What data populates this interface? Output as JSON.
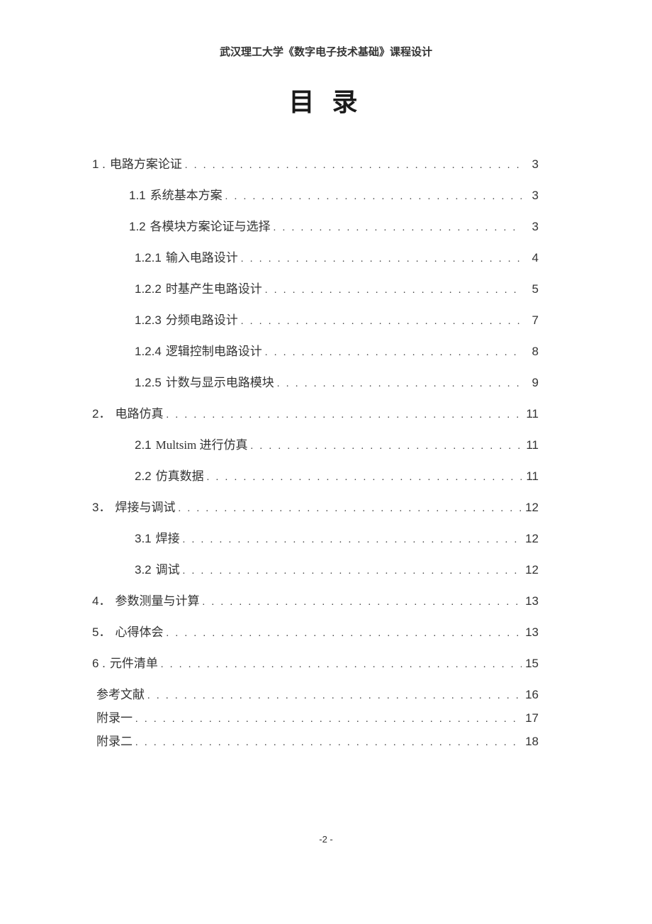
{
  "header": "武汉理工大学《数字电子技术基础》课程设计",
  "title": "目 录",
  "footer": "-2 -",
  "toc": [
    {
      "level": 0,
      "num": "1 .",
      "label": "电路方案论证",
      "page": "3",
      "tight": false
    },
    {
      "level": 1,
      "num": "1.1",
      "label": "系统基本方案",
      "page": "3",
      "tight": false
    },
    {
      "level": 1,
      "num": "1.2",
      "label": "各模块方案论证与选择",
      "page": "3",
      "tight": false
    },
    {
      "level": 2,
      "num": "1.2.1",
      "label": "输入电路设计",
      "page": "4",
      "tight": false
    },
    {
      "level": 2,
      "num": "1.2.2",
      "label": "时基产生电路设计",
      "page": "5",
      "tight": false
    },
    {
      "level": 2,
      "num": "1.2.3",
      "label": "分频电路设计",
      "page": "7",
      "tight": false
    },
    {
      "level": 2,
      "num": "1.2.4",
      "label": "逻辑控制电路设计",
      "page": "8",
      "tight": false
    },
    {
      "level": 2,
      "num": "1.2.5",
      "label": "计数与显示电路模块",
      "page": "9",
      "tight": false
    },
    {
      "level": 0,
      "num": "2．",
      "label": "电路仿真",
      "page": "11",
      "tight": false
    },
    {
      "level": 2,
      "num": "2.1",
      "label": "Multsim 进行仿真",
      "page": "11",
      "tight": false
    },
    {
      "level": 2,
      "num": "2.2",
      "label": "仿真数据",
      "page": "11",
      "tight": false
    },
    {
      "level": 0,
      "num": "3．",
      "label": "焊接与调试",
      "page": "12",
      "tight": false
    },
    {
      "level": 2,
      "num": "3.1",
      "label": "焊接",
      "page": "12",
      "tight": false
    },
    {
      "level": 2,
      "num": "3.2",
      "label": "调试",
      "page": "12",
      "tight": false
    },
    {
      "level": 0,
      "num": "4．",
      "label": "参数测量与计算",
      "page": "13",
      "tight": false
    },
    {
      "level": 0,
      "num": "5．",
      "label": "心得体会",
      "page": "13",
      "tight": false
    },
    {
      "level": 0,
      "num": "6 .",
      "label": "元件清单",
      "page": "15",
      "tight": false
    },
    {
      "level": 0,
      "num": "",
      "label": "参考文献",
      "page": "16",
      "tight": true
    },
    {
      "level": 0,
      "num": "",
      "label": "附录一",
      "page": "17",
      "tight": true
    },
    {
      "level": 0,
      "num": "",
      "label": "附录二",
      "page": "18",
      "tight": true
    }
  ]
}
